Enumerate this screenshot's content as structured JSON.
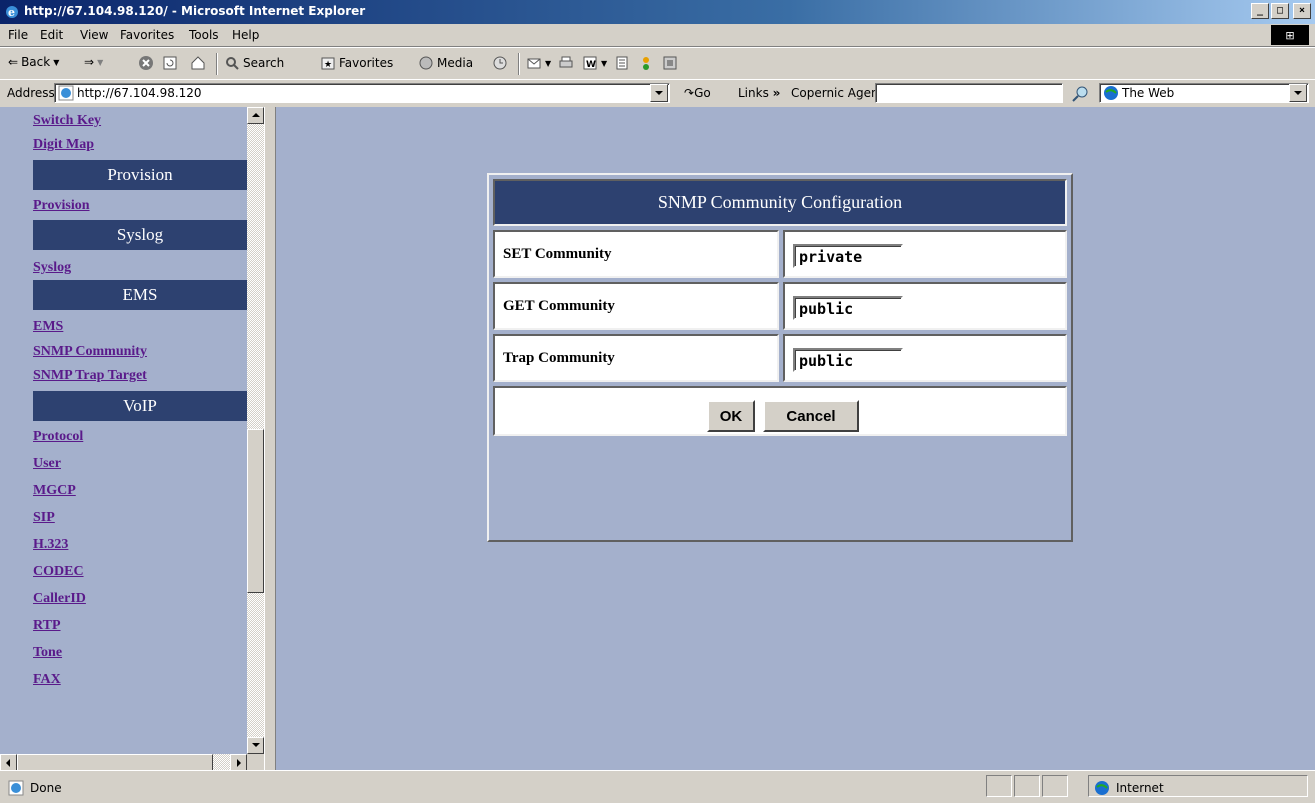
{
  "window": {
    "title": "http://67.104.98.120/ - Microsoft Internet Explorer"
  },
  "menu": [
    "File",
    "Edit",
    "View",
    "Favorites",
    "Tools",
    "Help"
  ],
  "toolbar": {
    "back": "Back",
    "search": "Search",
    "favorites": "Favorites",
    "media": "Media"
  },
  "address": {
    "label": "Address",
    "url": "http://67.104.98.120",
    "go": "Go",
    "links": "Links",
    "copernic": "Copernic Agent",
    "copernic_value": "",
    "web": "The Web"
  },
  "nav": {
    "switch_key": "Switch Key",
    "digit_map": "Digit Map",
    "provision_header": "Provision",
    "provision": "Provision",
    "syslog_header": "Syslog",
    "syslog": "Syslog",
    "ems_header": "EMS",
    "ems": "EMS",
    "snmp_community": "SNMP Community",
    "snmp_trap_target": "SNMP Trap Target",
    "voip_header": "VoIP",
    "protocol": "Protocol",
    "user": "User",
    "mgcp": "MGCP",
    "sip": "SIP",
    "h323": "H.323",
    "codec": "CODEC",
    "callerid": "CallerID",
    "rtp": "RTP",
    "tone": "Tone",
    "fax": "FAX"
  },
  "form": {
    "title": "SNMP Community Configuration",
    "set_label": "SET Community",
    "set_value": "private",
    "get_label": "GET Community",
    "get_value": "public",
    "trap_label": "Trap Community",
    "trap_value": "public",
    "ok": "OK",
    "cancel": "Cancel"
  },
  "status": {
    "text": "Done",
    "zone": "Internet"
  },
  "colors": {
    "nav_header": "#2d4170",
    "frame_bg": "#a4b0cc",
    "link": "#5a1a8a"
  }
}
